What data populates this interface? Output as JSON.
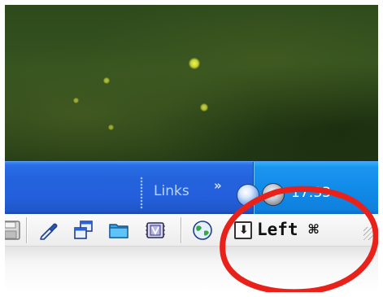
{
  "taskbar": {
    "links_label": "Links",
    "links_chevron": "»",
    "clock": "17:33",
    "colors": {
      "taskbar_blue": "#245fdb",
      "tray_blue": "#118be8"
    },
    "tray_icons": [
      "network-globe-icon",
      "volume-speaker-icon"
    ]
  },
  "toolbar": {
    "icons": [
      "disk-icon",
      "eyedropper-icon",
      "windows-icon",
      "folder-icon",
      "chip-icon",
      "globe-icon"
    ],
    "left_button": {
      "glyph": "⬇",
      "label": "Left ⌘"
    }
  },
  "annotation": {
    "color": "#e8221a",
    "shape": "red-ellipse-annotation"
  }
}
